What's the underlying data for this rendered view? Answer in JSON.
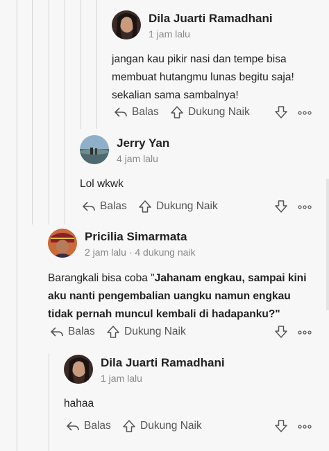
{
  "comments": [
    {
      "author": "Dila Juarti Ramadhani",
      "meta": "1 jam lalu",
      "body": [
        "jangan kau pikir nasi dan tempe bisa",
        "membuat hutangmu lunas begitu saja!",
        "sekalian sama sambalnya!"
      ],
      "actions": {
        "reply": "Balas",
        "upvote": "Dukung Naik",
        "more": "ooo"
      }
    },
    {
      "author": "Jerry Yan",
      "meta": "4 jam lalu",
      "body": [
        "Lol wkwk"
      ],
      "actions": {
        "reply": "Balas",
        "upvote": "Dukung Naik",
        "more": "ooo"
      }
    },
    {
      "author": "Pricilia Simarmata",
      "meta": "2 jam lalu · 4 dukung naik",
      "body_prefix": "Barangkali bisa coba \"",
      "body_bold": [
        "Jahanam engkau, sampai kini",
        "aku nanti pengembalian uangku namun engkau",
        "tidak pernah muncul kembali di hadapanku?\""
      ],
      "actions": {
        "reply": "Balas",
        "upvote": "Dukung Naik",
        "more": "ooo"
      }
    },
    {
      "author": "Dila Juarti Ramadhani",
      "meta": "1 jam lalu",
      "body": [
        "hahaa"
      ],
      "actions": {
        "reply": "Balas",
        "upvote": "Dukung Naik",
        "more": "ooo"
      }
    }
  ],
  "colors": {
    "background": "#f7f7f7",
    "thread_line": "#d4d4d4",
    "action_text": "#555555",
    "meta_text": "#888888"
  },
  "icons": [
    "reply-icon",
    "upvote-icon",
    "downvote-icon",
    "more-icon"
  ]
}
